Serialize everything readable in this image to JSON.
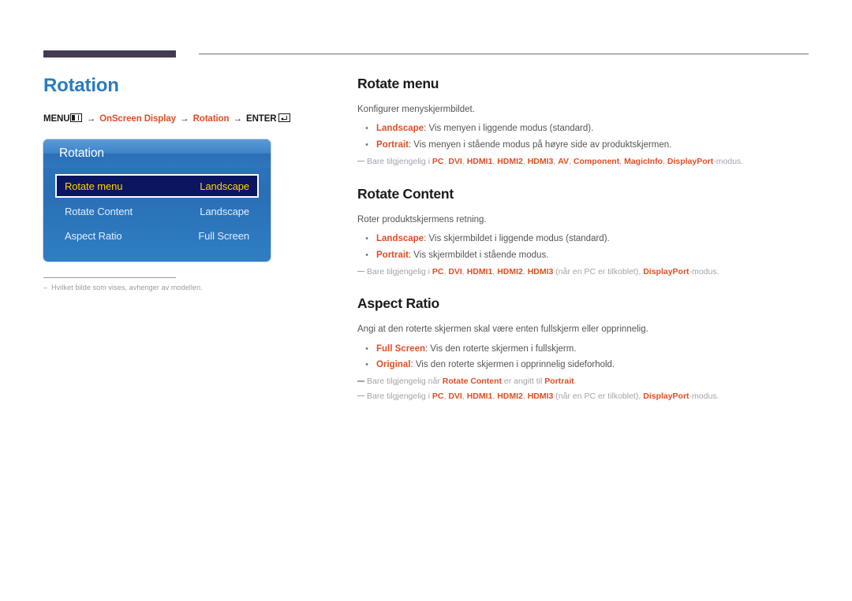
{
  "colors": {
    "accent_orange": "#e04e24",
    "title_blue": "#2b7cbd",
    "topbar_block": "#443a52",
    "osd_blue": "#2d76bf",
    "osd_selected_bg": "#0b1560",
    "osd_selected_text": "#ffd400",
    "note_gray": "#a4a2ab"
  },
  "left": {
    "page_title": "Rotation",
    "breadcrumb": {
      "menu_label": "MENU",
      "menu_icon": "menu-bars-icon",
      "arrow": "→",
      "item1": "OnScreen Display",
      "item2": "Rotation",
      "enter_label": "ENTER",
      "enter_icon": "enter-arrow-icon"
    },
    "osd": {
      "title": "Rotation",
      "rows": [
        {
          "label": "Rotate menu",
          "value": "Landscape",
          "selected": true
        },
        {
          "label": "Rotate Content",
          "value": "Landscape",
          "selected": false
        },
        {
          "label": "Aspect Ratio",
          "value": "Full Screen",
          "selected": false
        }
      ]
    },
    "note_dash": "–",
    "note": "Hvilket bilde som vises, avhenger av modellen."
  },
  "right": {
    "sections": [
      {
        "title": "Rotate menu",
        "intro": "Konfigurer menyskjermbildet.",
        "bullets": [
          {
            "term": "Landscape",
            "text": ": Vis menyen i liggende modus (standard)."
          },
          {
            "term": "Portrait",
            "text": ": Vis menyen i stående modus på høyre side av produktskjermen."
          }
        ],
        "notes": [
          {
            "prefix": "Bare tilgjengelig i ",
            "terms": [
              "PC",
              "DVI",
              "HDMI1",
              "HDMI2",
              "HDMI3",
              "AV",
              "Component",
              "MagicInfo",
              "DisplayPort"
            ],
            "suffix": "-modus."
          }
        ]
      },
      {
        "title": "Rotate Content",
        "intro": "Roter produktskjermens retning.",
        "bullets": [
          {
            "term": "Landscape",
            "text": ": Vis skjermbildet i liggende modus (standard)."
          },
          {
            "term": "Portrait",
            "text": ": Vis skjermbildet i stående modus."
          }
        ],
        "notes": [
          {
            "prefix": "Bare tilgjengelig i ",
            "terms": [
              "PC",
              "DVI",
              "HDMI1",
              "HDMI2",
              "HDMI3"
            ],
            "middle": " (når en PC er tilkoblet), ",
            "terms2": [
              "DisplayPort"
            ],
            "suffix": "-modus."
          }
        ]
      },
      {
        "title": "Aspect Ratio",
        "intro": "Angi at den roterte skjermen skal være enten fullskjerm eller opprinnelig.",
        "bullets": [
          {
            "term": "Full Screen",
            "text": ": Vis den roterte skjermen i fullskjerm."
          },
          {
            "term": "Original",
            "text": ": Vis den roterte skjermen i opprinnelig sideforhold."
          }
        ],
        "notes": [
          {
            "prefix": "Bare tilgjengelig når ",
            "terms": [
              "Rotate Content"
            ],
            "middle": " er angitt til ",
            "terms2": [
              "Portrait"
            ],
            "suffix": "."
          },
          {
            "prefix": "Bare tilgjengelig i ",
            "terms": [
              "PC",
              "DVI",
              "HDMI1",
              "HDMI2",
              "HDMI3"
            ],
            "middle": " (når en PC er tilkoblet), ",
            "terms2": [
              "DisplayPort"
            ],
            "suffix": "-modus."
          }
        ]
      }
    ]
  }
}
